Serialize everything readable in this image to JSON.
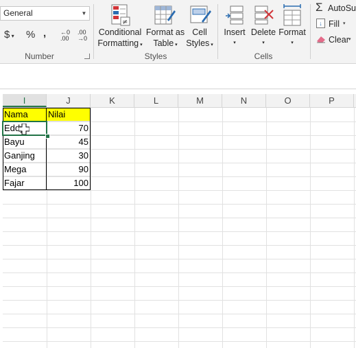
{
  "ribbon": {
    "number_format": {
      "value": "General"
    },
    "number_group": {
      "label": "Number",
      "currency": "$",
      "percent": "%",
      "comma": ",",
      "increase_decimal": "←0 .00",
      "decrease_decimal": ".00 →0"
    },
    "styles_group": {
      "label": "Styles",
      "conditional_formatting": [
        "Conditional",
        "Formatting"
      ],
      "format_as_table": [
        "Format as",
        "Table"
      ],
      "cell_styles": [
        "Cell",
        "Styles"
      ]
    },
    "cells_group": {
      "label": "Cells",
      "insert": "Insert",
      "delete": "Delete",
      "format": "Format"
    },
    "editing_group": {
      "autosum": "AutoSu",
      "fill": "Fill",
      "clear": "Clear"
    },
    "colors": {
      "accent_green": "#217346",
      "clear_pink": "#e46c8a",
      "delete_red": "#d13438",
      "fill_blue": "#2b6cb0"
    }
  },
  "sheet": {
    "columns": [
      "I",
      "J",
      "K",
      "L",
      "M",
      "N",
      "O",
      "P"
    ],
    "selected_column": "I",
    "header_row": {
      "col_i": "Nama",
      "col_j": "Nilai",
      "fill_color": "#ffff00"
    },
    "rows": [
      {
        "name": "Eddy",
        "value": "70"
      },
      {
        "name": "Bayu",
        "value": "45"
      },
      {
        "name": "Ganjing",
        "value": "30"
      },
      {
        "name": "Mega",
        "value": "90"
      },
      {
        "name": "Fajar",
        "value": "100"
      }
    ],
    "active_cell": "I2"
  }
}
